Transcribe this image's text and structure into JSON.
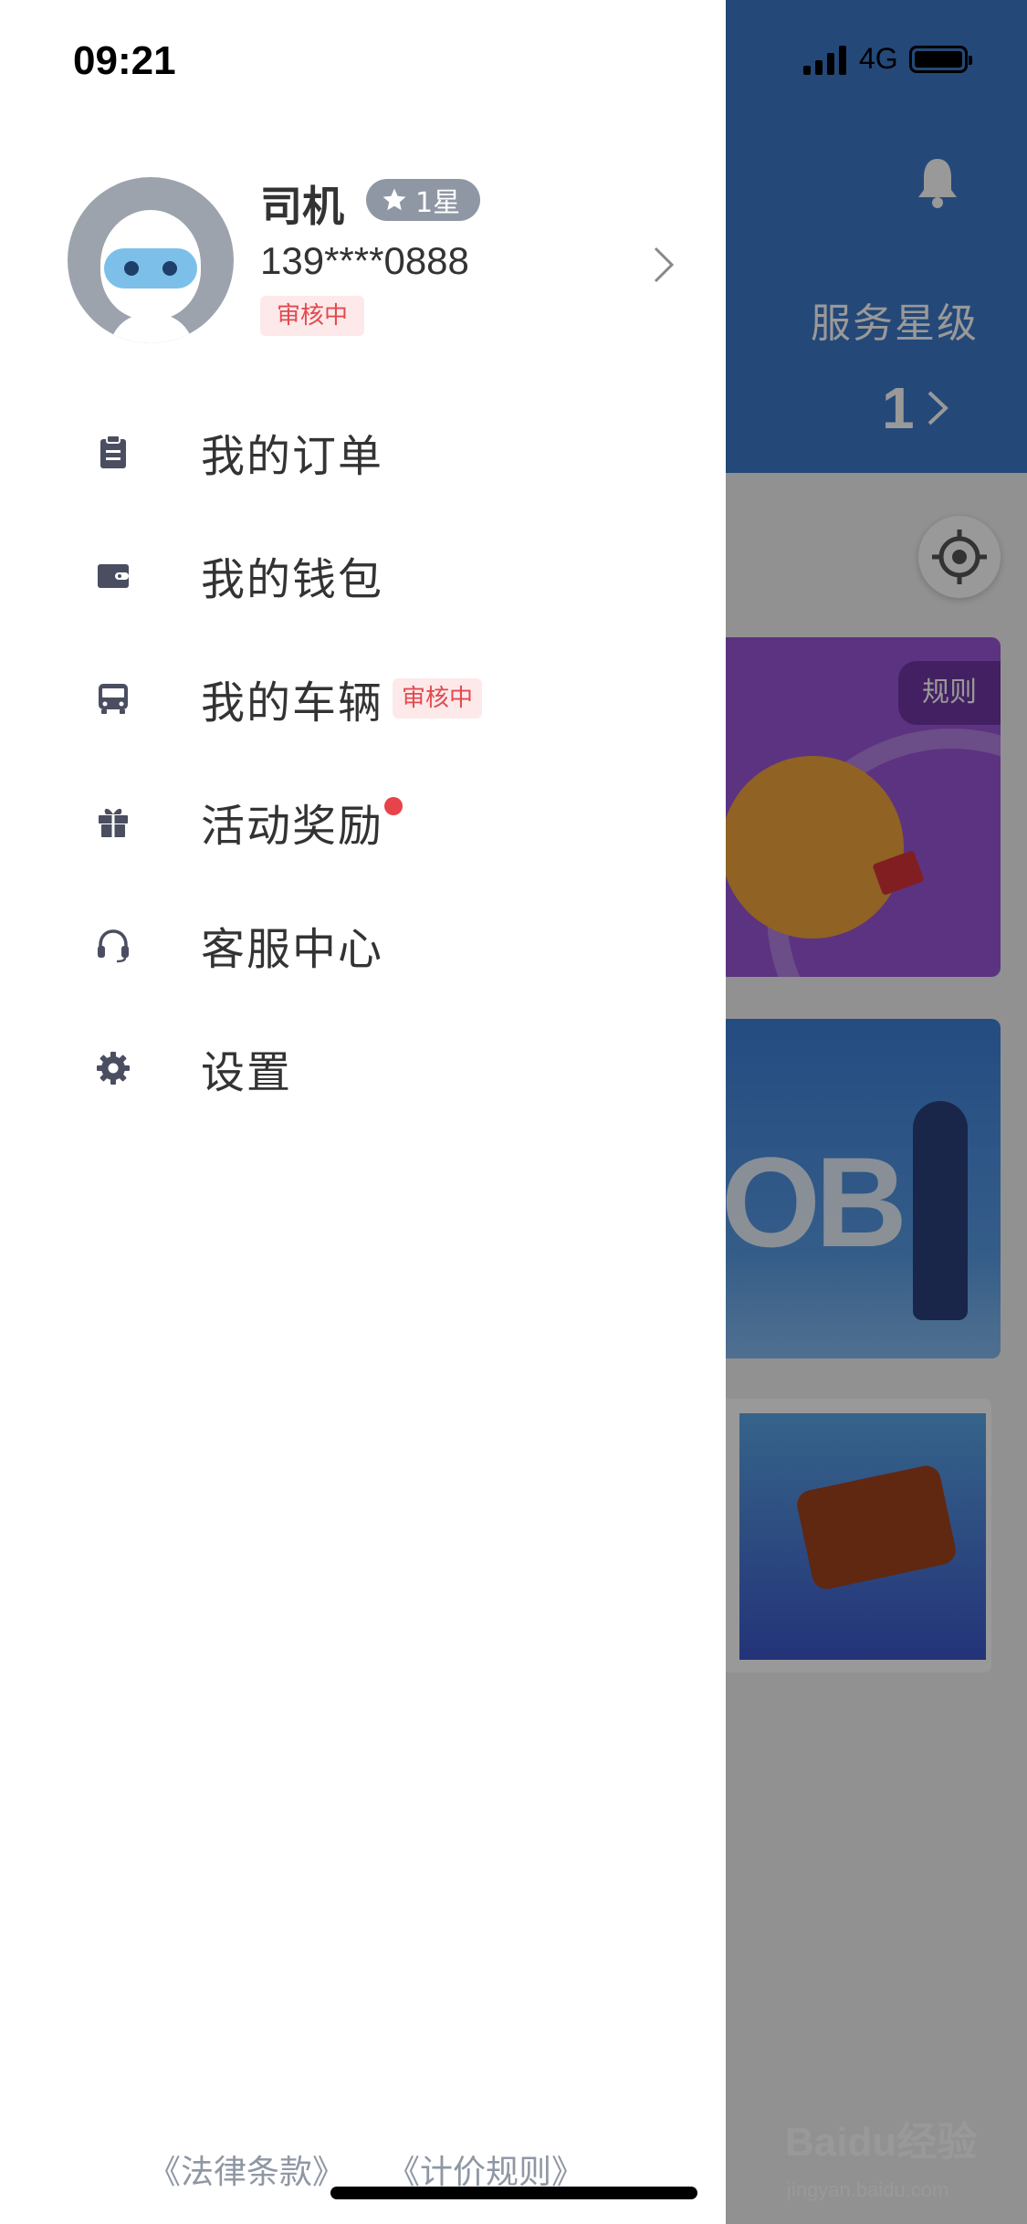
{
  "status_bar": {
    "time": "09:21",
    "network": "4G"
  },
  "background": {
    "service_level_label": "服务星级",
    "service_level_value": "1",
    "banner_rules_label": "规则",
    "watermark_text": "Baidu经验",
    "watermark_sub": "jingyan.baidu.com"
  },
  "profile": {
    "name": "司机",
    "star_rating": "1星",
    "phone": "139****0888",
    "status": "审核中"
  },
  "menu": [
    {
      "label": "我的订单",
      "icon": "clipboard-icon"
    },
    {
      "label": "我的钱包",
      "icon": "wallet-icon"
    },
    {
      "label": "我的车辆",
      "icon": "bus-icon",
      "badge": "审核中"
    },
    {
      "label": "活动奖励",
      "icon": "gift-icon",
      "notification_dot": true
    },
    {
      "label": "客服中心",
      "icon": "headset-icon"
    },
    {
      "label": "设置",
      "icon": "gear-icon"
    }
  ],
  "footer": {
    "legal_terms": "《法律条款》",
    "pricing_rules": "《计价规则》"
  },
  "colors": {
    "header_blue": "#3d79c9",
    "badge_bg": "#fde9ea",
    "badge_text": "#e24a4f",
    "icon_dark": "#4a4e60",
    "star_badge_bg": "#8f97a4"
  }
}
